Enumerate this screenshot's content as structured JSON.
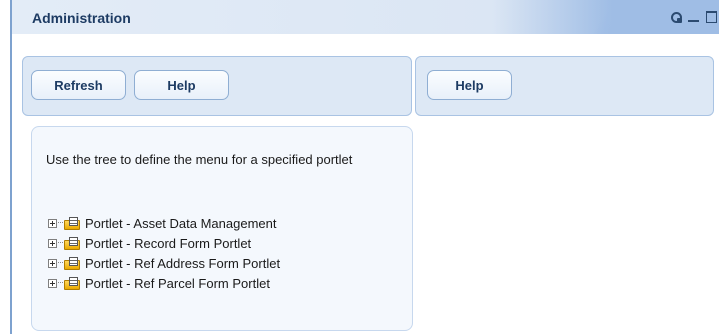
{
  "portlet": {
    "title": "Administration",
    "icons": [
      "settings-icon",
      "minimize-icon",
      "maximize-icon"
    ]
  },
  "left_panel": {
    "refresh_label": "Refresh",
    "help_label": "Help"
  },
  "right_panel": {
    "help_label": "Help"
  },
  "tree_panel": {
    "instructions": "Use the tree to define the menu for a specified portlet",
    "nodes": [
      {
        "label": "Portlet - Asset Data Management"
      },
      {
        "label": "Portlet - Record Form Portlet"
      },
      {
        "label": "Portlet - Ref Address Form Portlet"
      },
      {
        "label": "Portlet - Ref Parcel Form Portlet"
      }
    ]
  },
  "colors": {
    "header_gradient_end": "#9fbde5",
    "panel_background": "#dde8f5",
    "title_text": "#1d3b63",
    "folder": "#f2bd1d"
  }
}
